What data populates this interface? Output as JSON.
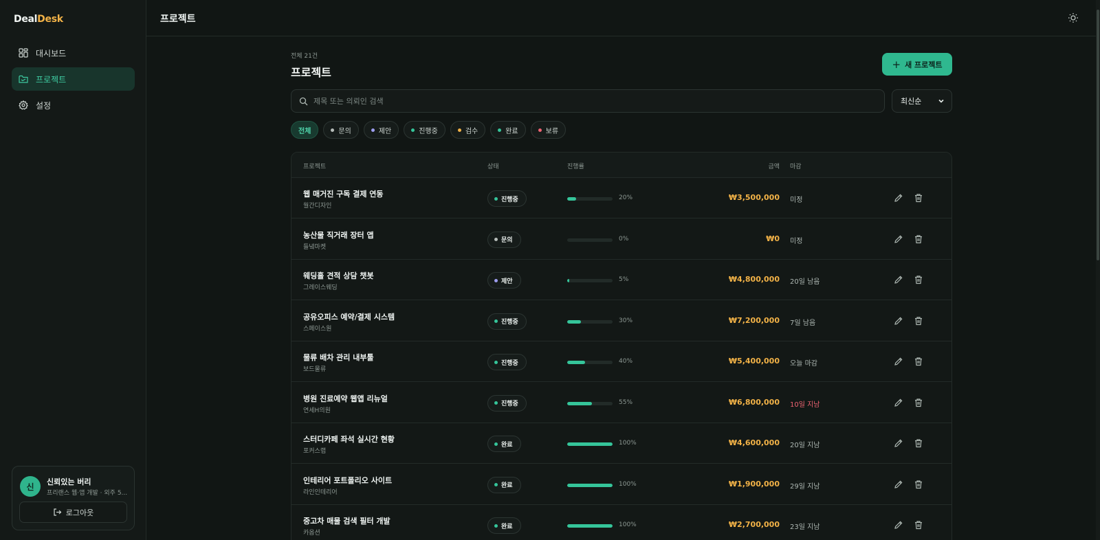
{
  "app": {
    "logo_main": "Deal",
    "logo_accent": "Desk"
  },
  "sidebar": {
    "items": [
      {
        "label": "대시보드",
        "icon": "dashboard-icon",
        "active": false
      },
      {
        "label": "프로젝트",
        "icon": "folder-icon",
        "active": true
      },
      {
        "label": "설정",
        "icon": "gear-icon",
        "active": false
      }
    ],
    "user": {
      "avatar_initial": "신",
      "name": "신뢰있는 버리",
      "subtitle": "프리랜스 웹·앱 개발 · 외주 5...",
      "logout_label": "로그아웃"
    }
  },
  "header": {
    "title": "프로젝트",
    "theme_icon": "sun-icon"
  },
  "main": {
    "count_label": "전체 21건",
    "title": "프로젝트",
    "new_button": "새 프로젝트",
    "search_placeholder": "제목 또는 의뢰인 검색",
    "sort_value": "최신순",
    "filters": [
      {
        "label": "전체",
        "active": true,
        "dot": ""
      },
      {
        "label": "문의",
        "active": false,
        "dot": "#b7bdba"
      },
      {
        "label": "제안",
        "active": false,
        "dot": "#9e9ef0"
      },
      {
        "label": "진행중",
        "active": false,
        "dot": "#35c59a"
      },
      {
        "label": "검수",
        "active": false,
        "dot": "#f2b247"
      },
      {
        "label": "완료",
        "active": false,
        "dot": "#35c59a"
      },
      {
        "label": "보류",
        "active": false,
        "dot": "#ef6372"
      }
    ]
  },
  "table": {
    "columns": {
      "project": "프로젝트",
      "status": "상태",
      "progress": "진행률",
      "amount": "금액",
      "due": "마감"
    },
    "rows": [
      {
        "title": "웹 매거진 구독 결제 연동",
        "client": "월간디자인",
        "status": "진행중",
        "status_color": "#35c59a",
        "progress": 20,
        "progress_label": "20%",
        "amount": "₩3,500,000",
        "due": "미정",
        "late": false
      },
      {
        "title": "농산물 직거래 장터 앱",
        "client": "들녘마켓",
        "status": "문의",
        "status_color": "#b7bdba",
        "progress": 0,
        "progress_label": "0%",
        "amount": "₩0",
        "due": "미정",
        "late": false
      },
      {
        "title": "웨딩홀 견적 상담 챗봇",
        "client": "그레이스웨딩",
        "status": "제안",
        "status_color": "#9e9ef0",
        "progress": 5,
        "progress_label": "5%",
        "amount": "₩4,800,000",
        "due": "20일 남음",
        "late": false
      },
      {
        "title": "공유오피스 예약/결제 시스템",
        "client": "스페이스원",
        "status": "진행중",
        "status_color": "#35c59a",
        "progress": 30,
        "progress_label": "30%",
        "amount": "₩7,200,000",
        "due": "7일 남음",
        "late": false
      },
      {
        "title": "물류 배차 관리 내부툴",
        "client": "보드물류",
        "status": "진행중",
        "status_color": "#35c59a",
        "progress": 40,
        "progress_label": "40%",
        "amount": "₩5,400,000",
        "due": "오늘 마감",
        "late": false
      },
      {
        "title": "병원 진료예약 웹앱 리뉴얼",
        "client": "연세H의원",
        "status": "진행중",
        "status_color": "#35c59a",
        "progress": 55,
        "progress_label": "55%",
        "amount": "₩6,800,000",
        "due": "10일 지남",
        "late": true
      },
      {
        "title": "스터디카페 좌석 실시간 현황",
        "client": "포커스랩",
        "status": "완료",
        "status_color": "#35c59a",
        "progress": 100,
        "progress_label": "100%",
        "amount": "₩4,600,000",
        "due": "20일 지남",
        "late": false
      },
      {
        "title": "인테리어 포트폴리오 사이트",
        "client": "라인인테리어",
        "status": "완료",
        "status_color": "#35c59a",
        "progress": 100,
        "progress_label": "100%",
        "amount": "₩1,900,000",
        "due": "29일 지남",
        "late": false
      },
      {
        "title": "중고차 매물 검색 필터 개발",
        "client": "카옵션",
        "status": "완료",
        "status_color": "#35c59a",
        "progress": 100,
        "progress_label": "100%",
        "amount": "₩2,700,000",
        "due": "23일 지남",
        "late": false
      }
    ]
  }
}
